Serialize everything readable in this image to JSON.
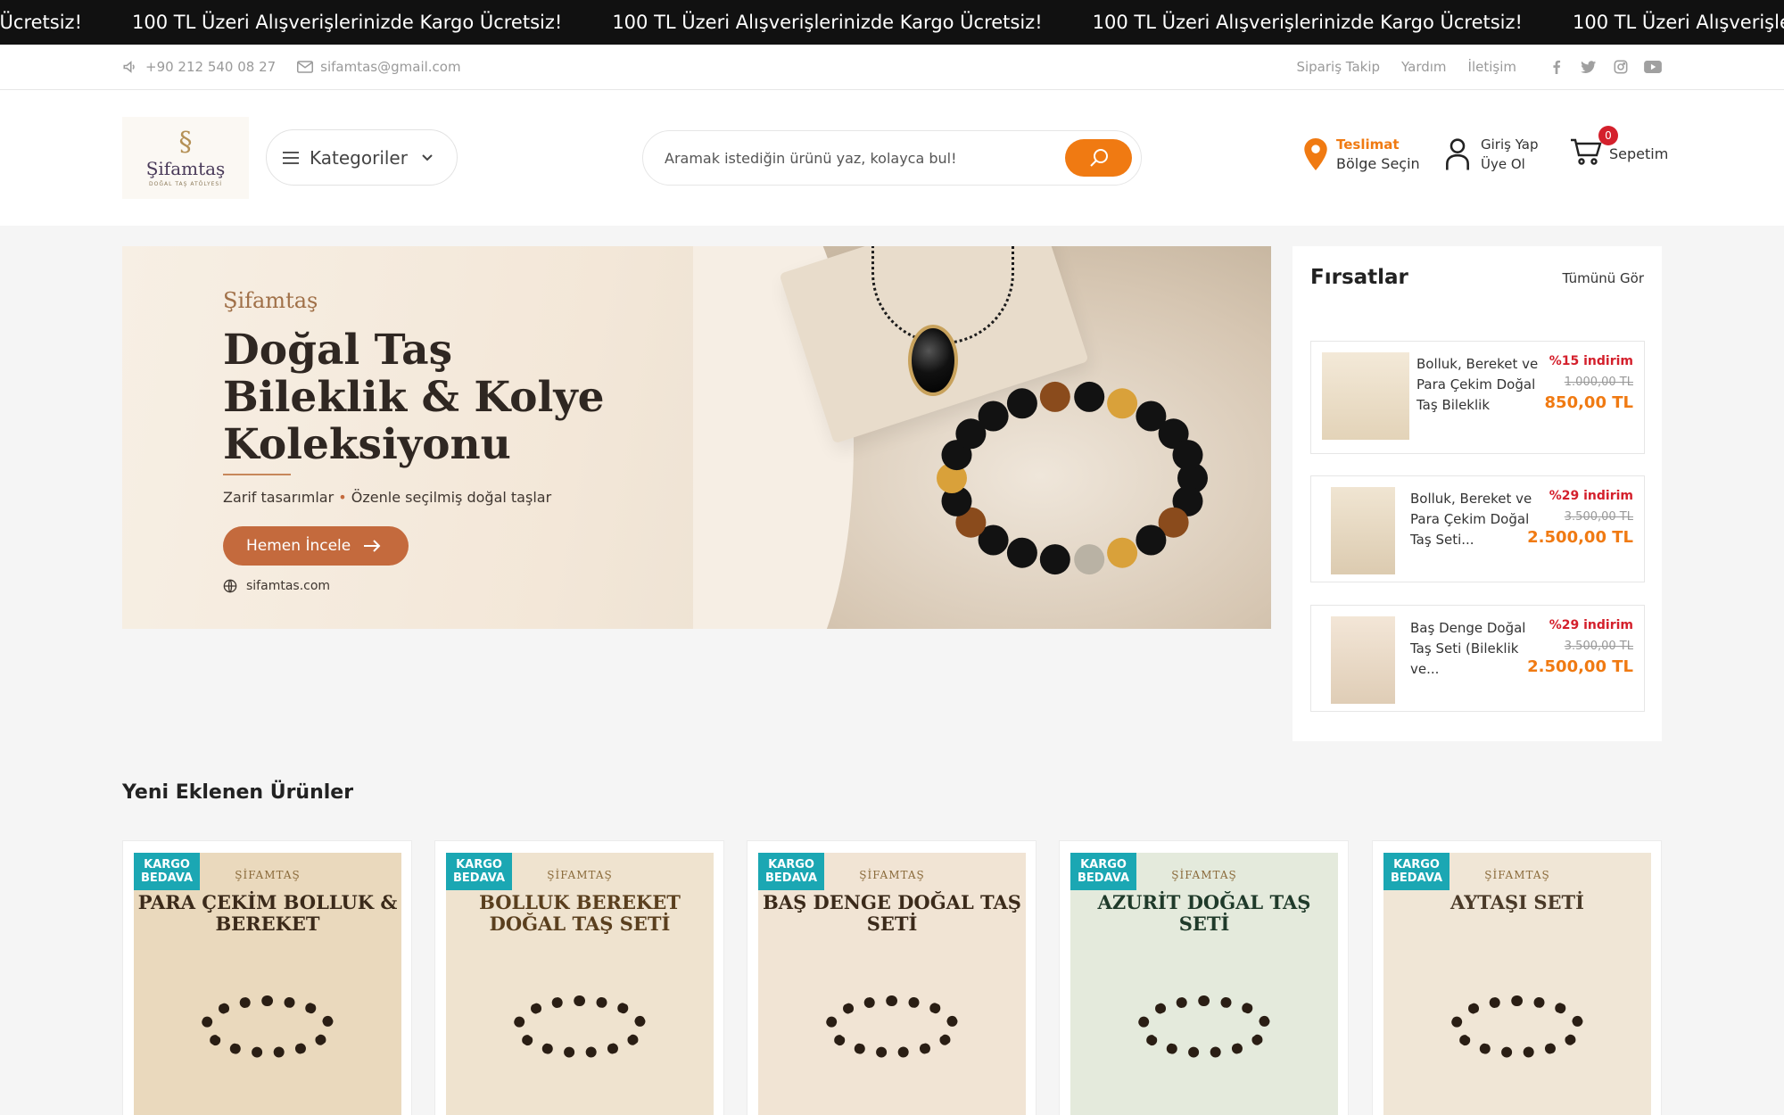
{
  "announcement": {
    "text": "100 TL Üzeri Alışverişlerinizde Kargo Ücretsiz!",
    "lead_text": "o Ücretsiz!"
  },
  "topbar": {
    "phone": "+90 212 540 08 27",
    "email": "sifamtas@gmail.com",
    "links": [
      "Sipariş Takip",
      "Yardım",
      "İletişim"
    ],
    "social_icons": [
      "facebook-icon",
      "twitter-icon",
      "instagram-icon",
      "youtube-icon"
    ]
  },
  "header": {
    "logo_name": "Şifamtaş",
    "logo_sub": "DOĞAL TAŞ ATÖLYESİ",
    "categories_label": "Kategoriler",
    "search_placeholder": "Aramak istediğin ürünü yaz, kolayca bul!",
    "delivery_label": "Teslimat",
    "delivery_sub": "Bölge Seçin",
    "login_label": "Giriş Yap",
    "register_label": "Üye Ol",
    "cart_label": "Sepetim",
    "cart_count": "0"
  },
  "hero": {
    "brand": "Şifamtaş",
    "title_line1": "Doğal Taş",
    "title_line2": "Bileklik & Kolye",
    "title_line3": "Koleksiyonu",
    "tagline_a": "Zarif tasarımlar",
    "tagline_b": "Özenle seçilmiş doğal taşlar",
    "cta": "Hemen İncele",
    "site": "sifamtas.com"
  },
  "deals": {
    "title": "Fırsatlar",
    "see_all": "Tümünü Gör",
    "items": [
      {
        "name": "Bolluk, Bereket ve Para Çekim Doğal Taş Bileklik",
        "discount": "%15 indirim",
        "old_price": "1.000,00 TL",
        "new_price": "850,00 TL"
      },
      {
        "name": "Bolluk, Bereket ve Para Çekim Doğal Taş Seti...",
        "discount": "%29 indirim",
        "old_price": "3.500,00 TL",
        "new_price": "2.500,00 TL"
      },
      {
        "name": "Baş Denge Doğal Taş Seti (Bileklik ve...",
        "discount": "%29 indirim",
        "old_price": "3.500,00 TL",
        "new_price": "2.500,00 TL"
      }
    ]
  },
  "new_products": {
    "title": "Yeni Eklenen Ürünler",
    "badge_line1": "KARGO",
    "badge_line2": "BEDAVA",
    "items": [
      {
        "brand": "ŞİFAMTAŞ",
        "poster_title": "PARA ÇEKİM BOLLUK & BEREKET",
        "bg": "#ead9bd",
        "ink": "#3b2a1a"
      },
      {
        "brand": "ŞİFAMTAŞ",
        "poster_title": "BOLLUK BEREKET DOĞAL TAŞ SETİ",
        "bg": "#efe3cf",
        "ink": "#5a3f1e"
      },
      {
        "brand": "ŞİFAMTAŞ",
        "poster_title": "BAŞ DENGE DOĞAL TAŞ SETİ",
        "bg": "#f1e4d4",
        "ink": "#3b2a1a"
      },
      {
        "brand": "ŞİFAMTAŞ",
        "poster_title": "AZURİT DOĞAL TAŞ SETİ",
        "bg": "#e4eadc",
        "ink": "#1f3a2a"
      },
      {
        "brand": "ŞİFAMTAŞ",
        "poster_title": "AYTAŞI SETİ",
        "bg": "#f0e6d6",
        "ink": "#4a3a28"
      }
    ]
  },
  "colors": {
    "accent": "#f07a12",
    "cta": "#c46a3d",
    "badge": "#1ba7b3",
    "sale": "#d4202c"
  }
}
